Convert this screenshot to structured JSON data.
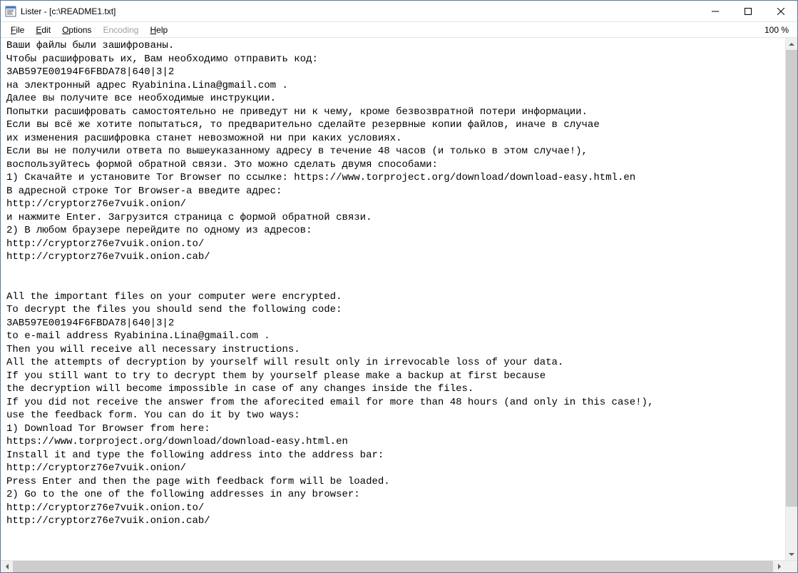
{
  "titlebar": {
    "text": "Lister - [c:\\README1.txt]"
  },
  "menubar": {
    "file": "File",
    "edit": "Edit",
    "options": "Options",
    "encoding": "Encoding",
    "help": "Help",
    "zoom": "100 %"
  },
  "content": "Ваши файлы были зашифрованы.\nЧтобы расшифровать их, Вам необходимо отправить код:\n3AB597E00194F6FBDA78|640|3|2\nна электронный адрес Ryabinina.Lina@gmail.com .\nДалее вы получите все необходимые инструкции.\nПопытки расшифровать самостоятельно не приведут ни к чему, кроме безвозвратной потери информации.\nЕсли вы всё же хотите попытаться, то предварительно сделайте резервные копии файлов, иначе в случае\nих изменения расшифровка станет невозможной ни при каких условиях.\nЕсли вы не получили ответа по вышеуказанному адресу в течение 48 часов (и только в этом случае!),\nвоспользуйтесь формой обратной связи. Это можно сделать двумя способами:\n1) Скачайте и установите Tor Browser по ссылке: https://www.torproject.org/download/download-easy.html.en\nВ адресной строке Tor Browser-а введите адрес:\nhttp://cryptorz76e7vuik.onion/\nи нажмите Enter. Загрузится страница с формой обратной связи.\n2) В любом браузере перейдите по одному из адресов:\nhttp://cryptorz76e7vuik.onion.to/\nhttp://cryptorz76e7vuik.onion.cab/\n\n\nAll the important files on your computer were encrypted.\nTo decrypt the files you should send the following code:\n3AB597E00194F6FBDA78|640|3|2\nto e-mail address Ryabinina.Lina@gmail.com .\nThen you will receive all necessary instructions.\nAll the attempts of decryption by yourself will result only in irrevocable loss of your data.\nIf you still want to try to decrypt them by yourself please make a backup at first because\nthe decryption will become impossible in case of any changes inside the files.\nIf you did not receive the answer from the aforecited email for more than 48 hours (and only in this case!),\nuse the feedback form. You can do it by two ways:\n1) Download Tor Browser from here:\nhttps://www.torproject.org/download/download-easy.html.en\nInstall it and type the following address into the address bar:\nhttp://cryptorz76e7vuik.onion/\nPress Enter and then the page with feedback form will be loaded.\n2) Go to the one of the following addresses in any browser:\nhttp://cryptorz76e7vuik.onion.to/\nhttp://cryptorz76e7vuik.onion.cab/"
}
